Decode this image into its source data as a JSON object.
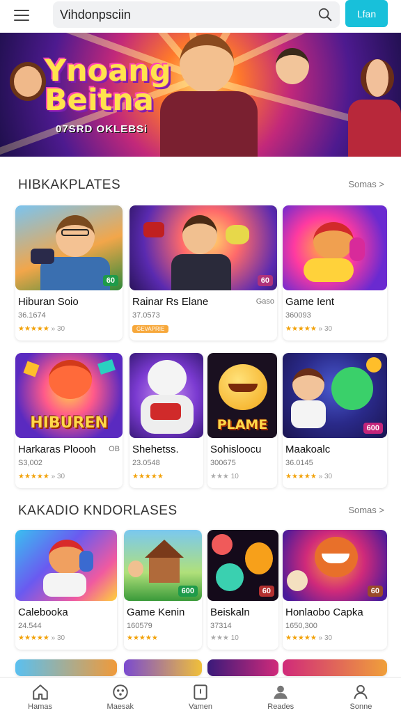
{
  "search": {
    "value": "Vihdonpsciin",
    "go_label": "Lfan"
  },
  "banner": {
    "title_line1": "Ynoang",
    "title_line2": "Beitna",
    "subtitle": "07SRD OKLEBSi"
  },
  "section1": {
    "title": "HIBKAKPLATES",
    "more": "Somas >",
    "row1": [
      {
        "title": "Hiburan Soio",
        "sub": "36.1674",
        "rating": "★★★★★",
        "count": "» 30",
        "badge": "60",
        "badge_color": "#1e9b4a"
      },
      {
        "title": "Rainar Rs Elane",
        "sub": "37.0573",
        "pill": "GEVAPRIE",
        "tag": "Gaso",
        "badge": "60",
        "badge_color": "#b0327a"
      },
      {
        "title": "Game Ient",
        "sub": "360093",
        "rating": "★★★★★",
        "count": "» 30",
        "badge": "",
        "badge_color": ""
      }
    ],
    "row2": [
      {
        "title": "Harkaras Ploooh",
        "tag": "OB",
        "sub": "S3,002",
        "rating": "★★★★★",
        "count": "» 30",
        "thumb_text": "HIBUREN"
      },
      {
        "title": "Shehetss.",
        "sub": "23.0548",
        "rating": "★★★★★",
        "count": ""
      },
      {
        "title": "Sohisloocu",
        "sub": "300675",
        "rating": "★★★",
        "count": "10",
        "thumb_text": "PLAME"
      },
      {
        "title": "Maakoalc",
        "sub": "36.0145",
        "rating": "★★★★★",
        "count": "» 30",
        "badge": "600",
        "badge_color": "#c4257a"
      }
    ]
  },
  "section2": {
    "title": "KAKADIO KNDORLASES",
    "more": "Somas >",
    "row": [
      {
        "title": "Calebooka",
        "sub": "24.544",
        "rating": "★★★★★",
        "count": "» 30"
      },
      {
        "title": "Game Kenin",
        "sub": "160579",
        "rating": "★★★★★",
        "count": "",
        "badge": "600",
        "badge_color": "#1e9b4a"
      },
      {
        "title": "Beiskaln",
        "sub": "37314",
        "rating": "★★★",
        "count": "10",
        "badge": "60",
        "badge_color": "#b23030"
      },
      {
        "title": "Honlaobo Capka",
        "sub": "1650,300",
        "rating": "★★★★★",
        "count": "» 30",
        "badge": "60",
        "badge_color": "#9a4a2a"
      }
    ]
  },
  "nav": {
    "items": [
      {
        "label": "Hamas",
        "icon": "home-icon"
      },
      {
        "label": "Maesak",
        "icon": "games-icon"
      },
      {
        "label": "Vamen",
        "icon": "apps-icon"
      },
      {
        "label": "Reades",
        "icon": "person-icon"
      },
      {
        "label": "Sonne",
        "icon": "profile-icon"
      }
    ]
  }
}
